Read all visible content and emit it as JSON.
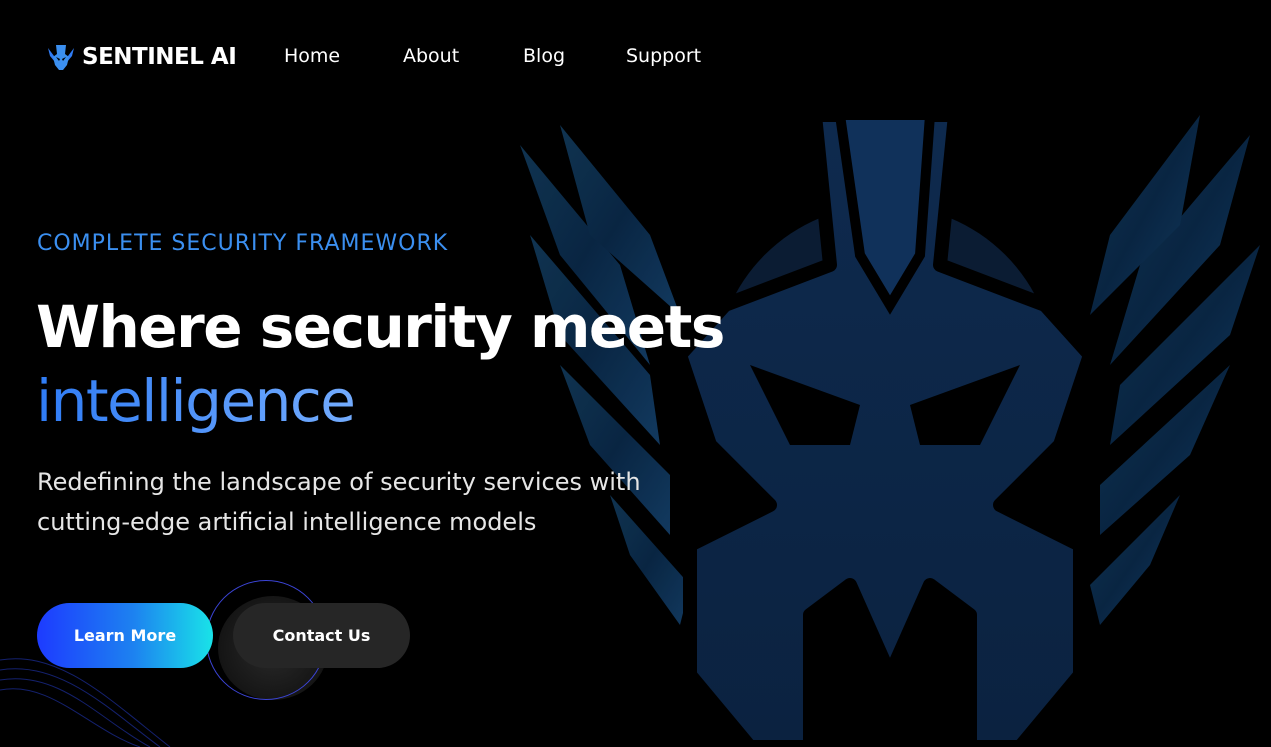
{
  "brand": {
    "name": "SENTINEL AI",
    "icon": "winged-helmet-icon"
  },
  "nav": {
    "items": [
      {
        "label": "Home"
      },
      {
        "label": "About"
      },
      {
        "label": "Blog"
      },
      {
        "label": "Support"
      }
    ]
  },
  "hero": {
    "eyebrow": "COMPLETE SECURITY FRAMEWORK",
    "headline_line1": "Where security meets",
    "headline_accent": "intelligence",
    "subtitle": "Redefining the landscape of security services with cutting-edge artificial intelligence models",
    "primary_button": "Learn More",
    "secondary_button": "Contact Us",
    "emblem": "winged-helmet-emblem"
  },
  "colors": {
    "background": "#000000",
    "accent_blue": "#3b8ff0",
    "button_gradient_start": "#1d3bff",
    "button_gradient_end": "#19e3e8",
    "secondary_button": "#262626",
    "emblem_fill": "#0c2140"
  }
}
